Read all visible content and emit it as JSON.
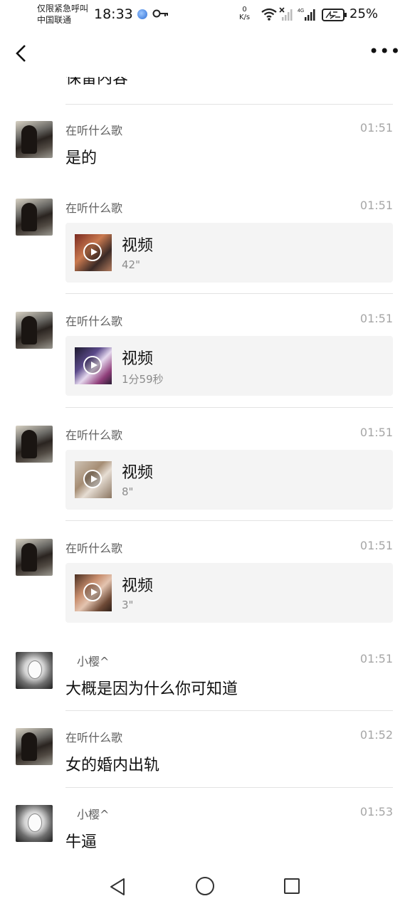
{
  "status_bar": {
    "line1": "仅限紧急呼叫",
    "carrier": "中国联通",
    "time": "18:33",
    "speed_value": "0",
    "speed_unit": "K/s",
    "network": "4G",
    "battery": "25%"
  },
  "partial_message": "保留内容",
  "messages": [
    {
      "sender": "在听什么歌",
      "time": "01:51",
      "type": "text",
      "text": "是的",
      "avatar": "dark-photo"
    },
    {
      "sender": "在听什么歌",
      "time": "01:51",
      "type": "video",
      "title": "视频",
      "duration": "42\"",
      "avatar": "dark-photo"
    },
    {
      "sender": "在听什么歌",
      "time": "01:51",
      "type": "video",
      "title": "视频",
      "duration": "1分59秒",
      "avatar": "dark-photo"
    },
    {
      "sender": "在听什么歌",
      "time": "01:51",
      "type": "video",
      "title": "视频",
      "duration": "8\"",
      "avatar": "dark-photo"
    },
    {
      "sender": "在听什么歌",
      "time": "01:51",
      "type": "video",
      "title": "视频",
      "duration": "3\"",
      "avatar": "dark-photo"
    },
    {
      "sender": "小樱^",
      "time": "01:51",
      "type": "text",
      "text": "大概是因为什么你可知道",
      "avatar": "anime"
    },
    {
      "sender": "在听什么歌",
      "time": "01:52",
      "type": "text",
      "text": "女的婚内出轨",
      "avatar": "dark-photo"
    },
    {
      "sender": "小樱^",
      "time": "01:53",
      "type": "text",
      "text": "牛逼",
      "avatar": "anime"
    }
  ],
  "top_bar": {
    "more_label": "•••"
  },
  "icons": [
    "back-icon",
    "more-icon",
    "play-icon",
    "nav-back-icon",
    "nav-home-icon",
    "nav-recent-icon"
  ]
}
